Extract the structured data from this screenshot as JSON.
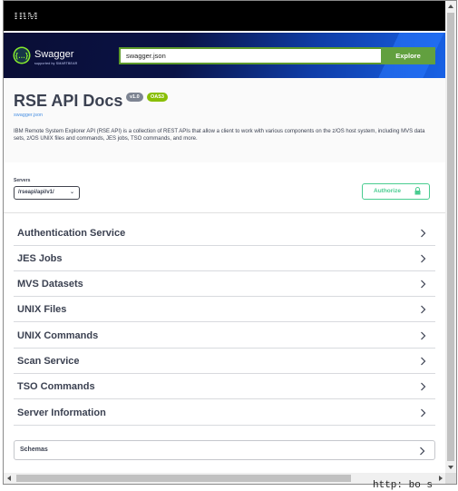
{
  "ibm_bar": {
    "logo": "IBM"
  },
  "topbar": {
    "brand": "Swagger",
    "brand_sub": "supported by SMARTBEAR",
    "spec_url_value": "swagger.json",
    "explore_label": "Explore"
  },
  "info": {
    "title": "RSE API Docs",
    "version_badge": "v1.0",
    "oas_badge": "OAS3",
    "spec_link": "swagger.json",
    "description": "IBM Remote System Explorer API (RSE API) is a collection of REST APIs that allow a client to work with various components on the z/OS host system, including MVS data sets, z/OS UNIX files and commands, JES jobs, TSO commands, and more."
  },
  "servers": {
    "label": "Servers",
    "selected": "/rseapi/api/v1/"
  },
  "authorize": {
    "label": "Authorize"
  },
  "tags": [
    {
      "label": "Authentication Service"
    },
    {
      "label": "JES Jobs"
    },
    {
      "label": "MVS Datasets"
    },
    {
      "label": "UNIX Files"
    },
    {
      "label": "UNIX Commands"
    },
    {
      "label": "Scan Service"
    },
    {
      "label": "TSO Commands"
    },
    {
      "label": "Server Information"
    }
  ],
  "schemas": {
    "label": "Schemas"
  },
  "background_text": "http: bo  s",
  "colors": {
    "explore_green": "#62a03f",
    "authorize_green": "#49cc90",
    "oas_badge": "#89bf04",
    "version_badge": "#7d8492",
    "text": "#3b4151"
  },
  "icons": [
    "swagger-logo-icon",
    "lock-icon",
    "chevron-right-icon",
    "chevron-down-icon"
  ]
}
